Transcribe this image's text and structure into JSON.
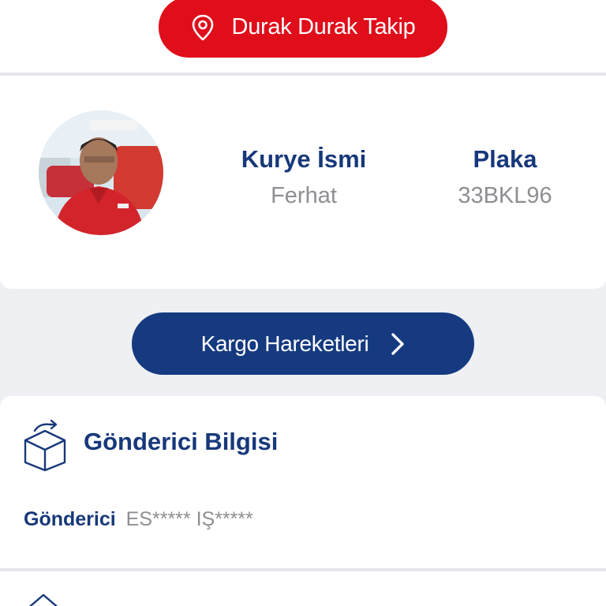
{
  "track_button": {
    "label": "Durak Durak Takip",
    "icon": "location-pin-icon",
    "color": "#e00d1a"
  },
  "courier": {
    "avatar": "courier-photo",
    "name_label": "Kurye İsmi",
    "name_value": "Ferhat",
    "plate_label": "Plaka",
    "plate_value": "33BKL96"
  },
  "moves_button": {
    "label": "Kargo Hareketleri",
    "icon": "chevron-right-icon",
    "color": "#163a80"
  },
  "sender": {
    "icon": "package-box-icon",
    "title": "Gönderici Bilgisi",
    "field_label": "Gönderici",
    "field_value": "ES***** IŞ*****"
  },
  "colors": {
    "accent_red": "#e00d1a",
    "brand_navy": "#17387a",
    "muted_text": "#8e8e93",
    "background": "#eef0f4"
  }
}
